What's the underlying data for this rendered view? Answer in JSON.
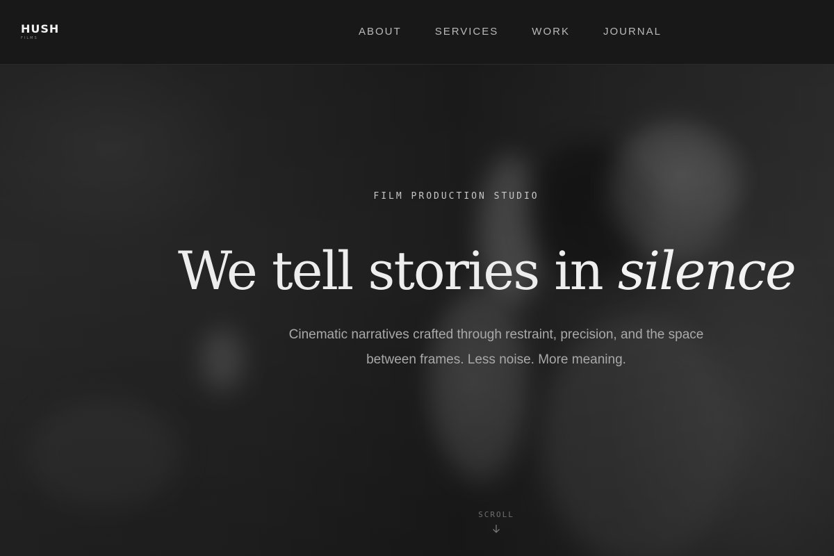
{
  "brand": {
    "name": "HUSH",
    "tagline": "FILMS"
  },
  "nav": {
    "items": [
      {
        "label": "ABOUT"
      },
      {
        "label": "SERVICES"
      },
      {
        "label": "WORK"
      },
      {
        "label": "JOURNAL"
      }
    ]
  },
  "hero": {
    "eyebrow": "FILM PRODUCTION STUDIO",
    "headline_main": "We tell stories in ",
    "headline_accent": "silence",
    "subtext": "Cinematic narratives crafted through restraint, precision, and the space between frames. Less noise. More meaning.",
    "scroll_label": "SCROLL",
    "scroll_icon": "arrow-down-icon"
  },
  "colors": {
    "background": "#181818",
    "text_primary": "#ededed",
    "text_muted": "#a9a9a9"
  }
}
